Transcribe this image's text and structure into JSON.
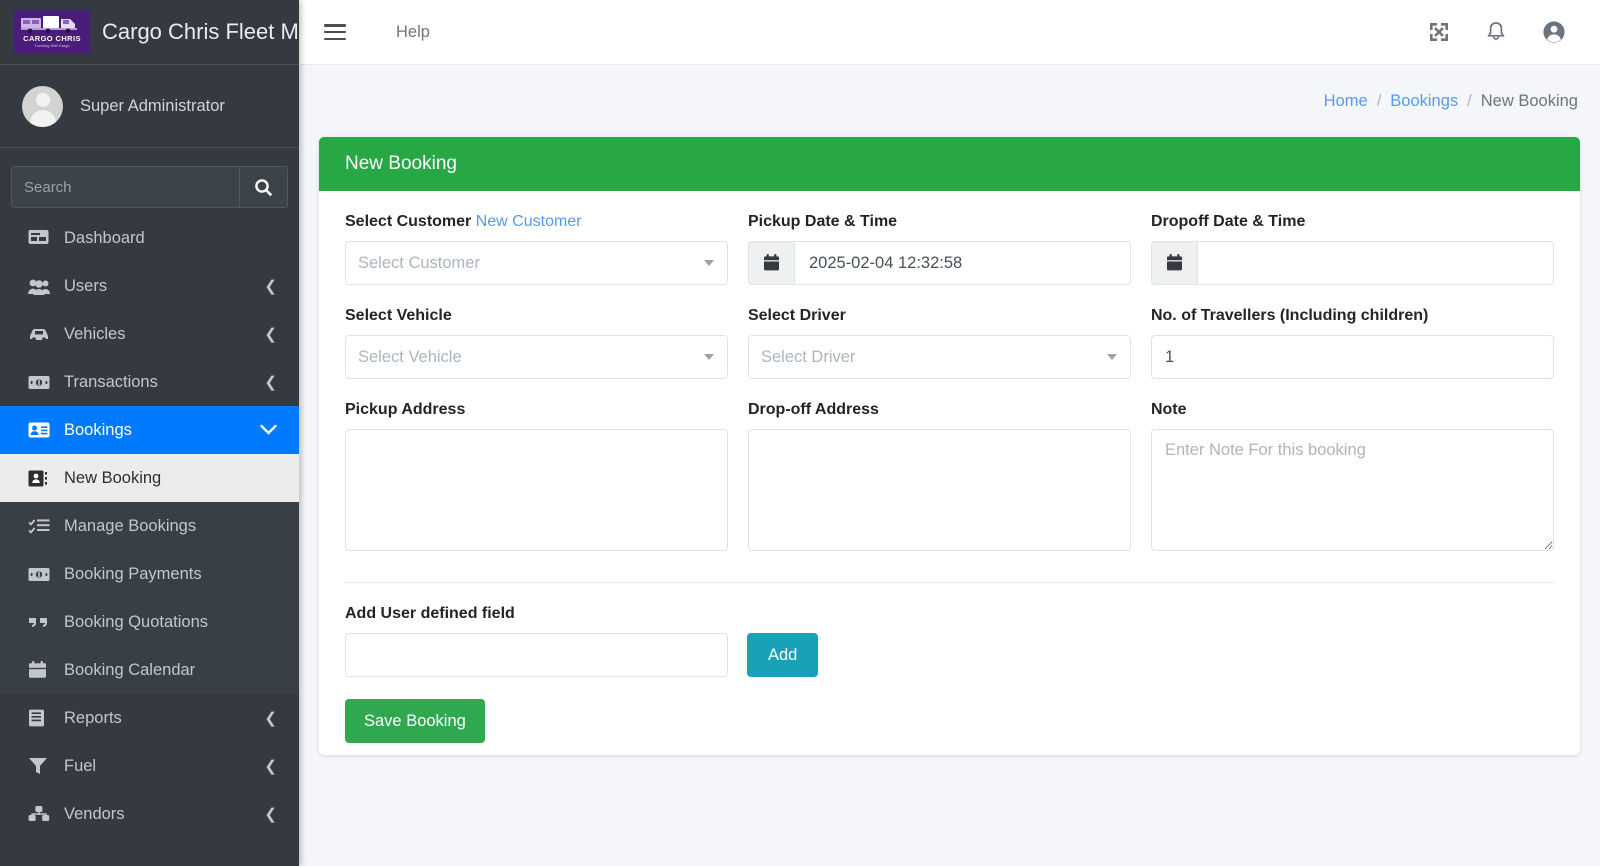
{
  "brand": {
    "title": "Cargo Chris Fleet Management",
    "logo_name": "CARGO CHRIS",
    "logo_tagline": "Trucking Wet Cargo",
    "logo_icon": "truck-icon",
    "logo_color": "#4b1d7a"
  },
  "sidebar": {
    "user_name": "Super Administrator",
    "avatar_icon": "user-avatar-icon",
    "search": {
      "placeholder": "Search",
      "value": "",
      "button_icon": "search-icon"
    },
    "items": [
      {
        "label": "Dashboard",
        "icon": "dashboard-icon",
        "caret": "",
        "active": false
      },
      {
        "label": "Users",
        "icon": "users-icon",
        "caret": "❮",
        "active": false
      },
      {
        "label": "Vehicles",
        "icon": "car-icon",
        "caret": "❮",
        "active": false
      },
      {
        "label": "Transactions",
        "icon": "money-bill-icon",
        "caret": "❮",
        "active": false
      },
      {
        "label": "Bookings",
        "icon": "id-card-icon",
        "caret": "❯",
        "active": true
      },
      {
        "label": "Reports",
        "icon": "book-icon",
        "caret": "❮",
        "active": false
      },
      {
        "label": "Fuel",
        "icon": "funnel-icon",
        "caret": "❮",
        "active": false
      },
      {
        "label": "Vendors",
        "icon": "vendors-icon",
        "caret": "❮",
        "active": false
      }
    ],
    "submenu": [
      {
        "label": "New Booking",
        "icon": "address-book-icon",
        "current": true
      },
      {
        "label": "Manage Bookings",
        "icon": "task-list-icon",
        "current": false
      },
      {
        "label": "Booking Payments",
        "icon": "money-bill-icon",
        "current": false
      },
      {
        "label": "Booking Quotations",
        "icon": "quote-icon",
        "current": false
      },
      {
        "label": "Booking Calendar",
        "icon": "calendar-icon",
        "current": false
      }
    ],
    "active_color": "#007bff"
  },
  "header": {
    "menu_toggle_icon": "hamburger-icon",
    "help_label": "Help",
    "icons": [
      {
        "name": "fullscreen-expand-icon"
      },
      {
        "name": "bell-notification-icon"
      },
      {
        "name": "user-account-icon"
      }
    ]
  },
  "breadcrumb": {
    "home": "Home",
    "parent": "Bookings",
    "current": "New Booking",
    "separator": "/"
  },
  "card": {
    "title": "New Booking",
    "header_color": "#28a745"
  },
  "form": {
    "select_customer": {
      "label": "Select Customer",
      "link_label": "New Customer",
      "placeholder": "Select Customer",
      "value": ""
    },
    "pickup_datetime": {
      "label": "Pickup Date & Time",
      "value": "2025-02-04 12:32:58",
      "icon": "calendar-icon"
    },
    "dropoff_datetime": {
      "label": "Dropoff Date & Time",
      "value": "",
      "icon": "calendar-icon"
    },
    "select_vehicle": {
      "label": "Select Vehicle",
      "placeholder": "Select Vehicle",
      "value": ""
    },
    "select_driver": {
      "label": "Select Driver",
      "placeholder": "Select Driver",
      "value": ""
    },
    "travellers": {
      "label": "No. of Travellers (Including children)",
      "value": "1"
    },
    "pickup_address": {
      "label": "Pickup Address",
      "value": "",
      "placeholder": ""
    },
    "dropoff_address": {
      "label": "Drop-off Address",
      "value": "",
      "placeholder": ""
    },
    "note": {
      "label": "Note",
      "placeholder": "Enter Note For this booking",
      "value": ""
    },
    "user_defined_field": {
      "label": "Add User defined field",
      "value": "",
      "add_button": "Add",
      "add_button_color": "#17a2b8"
    },
    "save_button": "Save Booking",
    "save_button_color": "#2fa84f"
  }
}
